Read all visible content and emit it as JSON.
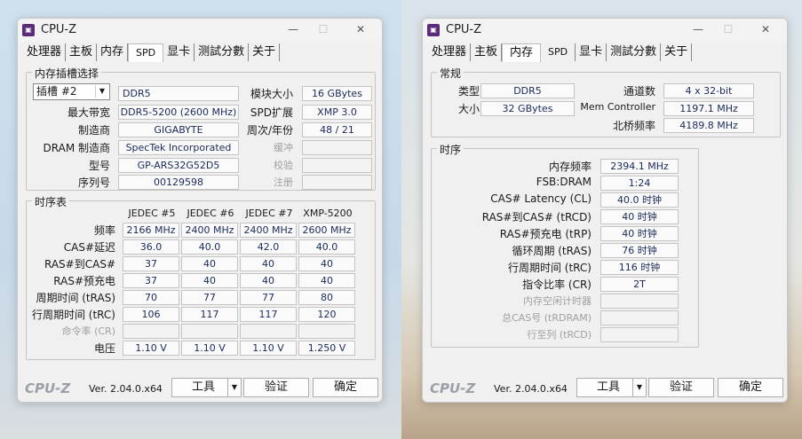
{
  "app": {
    "title": "CPU-Z",
    "version": "Ver. 2.04.0.x64",
    "logo": "CPU-Z"
  },
  "tabs": [
    "处理器",
    "主板",
    "内存",
    "SPD",
    "显卡",
    "测試分數",
    "关于"
  ],
  "buttons": {
    "tools": "工具",
    "validate": "验证",
    "ok": "确定"
  },
  "spd": {
    "slot_group": "内存插槽选择",
    "slot_select": "插槽 #2",
    "type": "DDR5",
    "labels": {
      "module_size": "模块大小",
      "max_bw": "最大带宽",
      "spd_ext": "SPD扩展",
      "manufacturer": "制造商",
      "week_year": "周次/年份",
      "dram_mfr": "DRAM 制造商",
      "buffered": "缓冲",
      "part": "型号",
      "correction": "校验",
      "serial": "序列号",
      "registered": "注册"
    },
    "values": {
      "module_size": "16 GBytes",
      "max_bw": "DDR5-5200 (2600 MHz)",
      "spd_ext": "XMP 3.0",
      "manufacturer": "GIGABYTE",
      "week_year": "48 / 21",
      "dram_mfr": "SpecTek Incorporated",
      "part": "GP-ARS32G52D5",
      "serial": "00129598"
    },
    "timing_group": "时序表",
    "columns": [
      "JEDEC #5",
      "JEDEC #6",
      "JEDEC #7",
      "XMP-5200"
    ],
    "rows": [
      {
        "label": "频率",
        "cells": [
          "2166 MHz",
          "2400 MHz",
          "2400 MHz",
          "2600 MHz"
        ]
      },
      {
        "label": "CAS#延迟",
        "cells": [
          "36.0",
          "40.0",
          "42.0",
          "40.0"
        ]
      },
      {
        "label": "RAS#到CAS#",
        "cells": [
          "37",
          "40",
          "40",
          "40"
        ]
      },
      {
        "label": "RAS#预充电",
        "cells": [
          "37",
          "40",
          "40",
          "40"
        ]
      },
      {
        "label": "周期时间 (tRAS)",
        "cells": [
          "70",
          "77",
          "77",
          "80"
        ]
      },
      {
        "label": "行周期时间 (tRC)",
        "cells": [
          "106",
          "117",
          "117",
          "120"
        ]
      },
      {
        "label": "命令率 (CR)",
        "cells": [
          "",
          "",
          "",
          ""
        ]
      },
      {
        "label": "电压",
        "cells": [
          "1.10 V",
          "1.10 V",
          "1.10 V",
          "1.250 V"
        ]
      }
    ]
  },
  "memory": {
    "general_group": "常规",
    "labels": {
      "type": "类型",
      "size": "大小",
      "channels": "通道数",
      "mem_ctrl": "Mem Controller",
      "nb_freq": "北桥频率"
    },
    "values": {
      "type": "DDR5",
      "size": "32 GBytes",
      "channels": "4 x 32-bit",
      "mem_ctrl": "1197.1 MHz",
      "nb_freq": "4189.8 MHz"
    },
    "timing_group": "时序",
    "rows": [
      {
        "label": "内存频率",
        "value": "2394.1 MHz",
        "dim": false
      },
      {
        "label": "FSB:DRAM",
        "value": "1:24",
        "dim": false
      },
      {
        "label": "CAS# Latency (CL)",
        "value": "40.0 时钟",
        "dim": false
      },
      {
        "label": "RAS#到CAS# (tRCD)",
        "value": "40 时钟",
        "dim": false
      },
      {
        "label": "RAS#预充电 (tRP)",
        "value": "40 时钟",
        "dim": false
      },
      {
        "label": "循环周期 (tRAS)",
        "value": "76 时钟",
        "dim": false
      },
      {
        "label": "行周期时间 (tRC)",
        "value": "116 时钟",
        "dim": false
      },
      {
        "label": "指令比率 (CR)",
        "value": "2T",
        "dim": false
      },
      {
        "label": "内存空闲计时器",
        "value": "",
        "dim": true
      },
      {
        "label": "总CAS号 (tRDRAM)",
        "value": "",
        "dim": true
      },
      {
        "label": "行至列 (tRCD)",
        "value": "",
        "dim": true
      }
    ]
  }
}
